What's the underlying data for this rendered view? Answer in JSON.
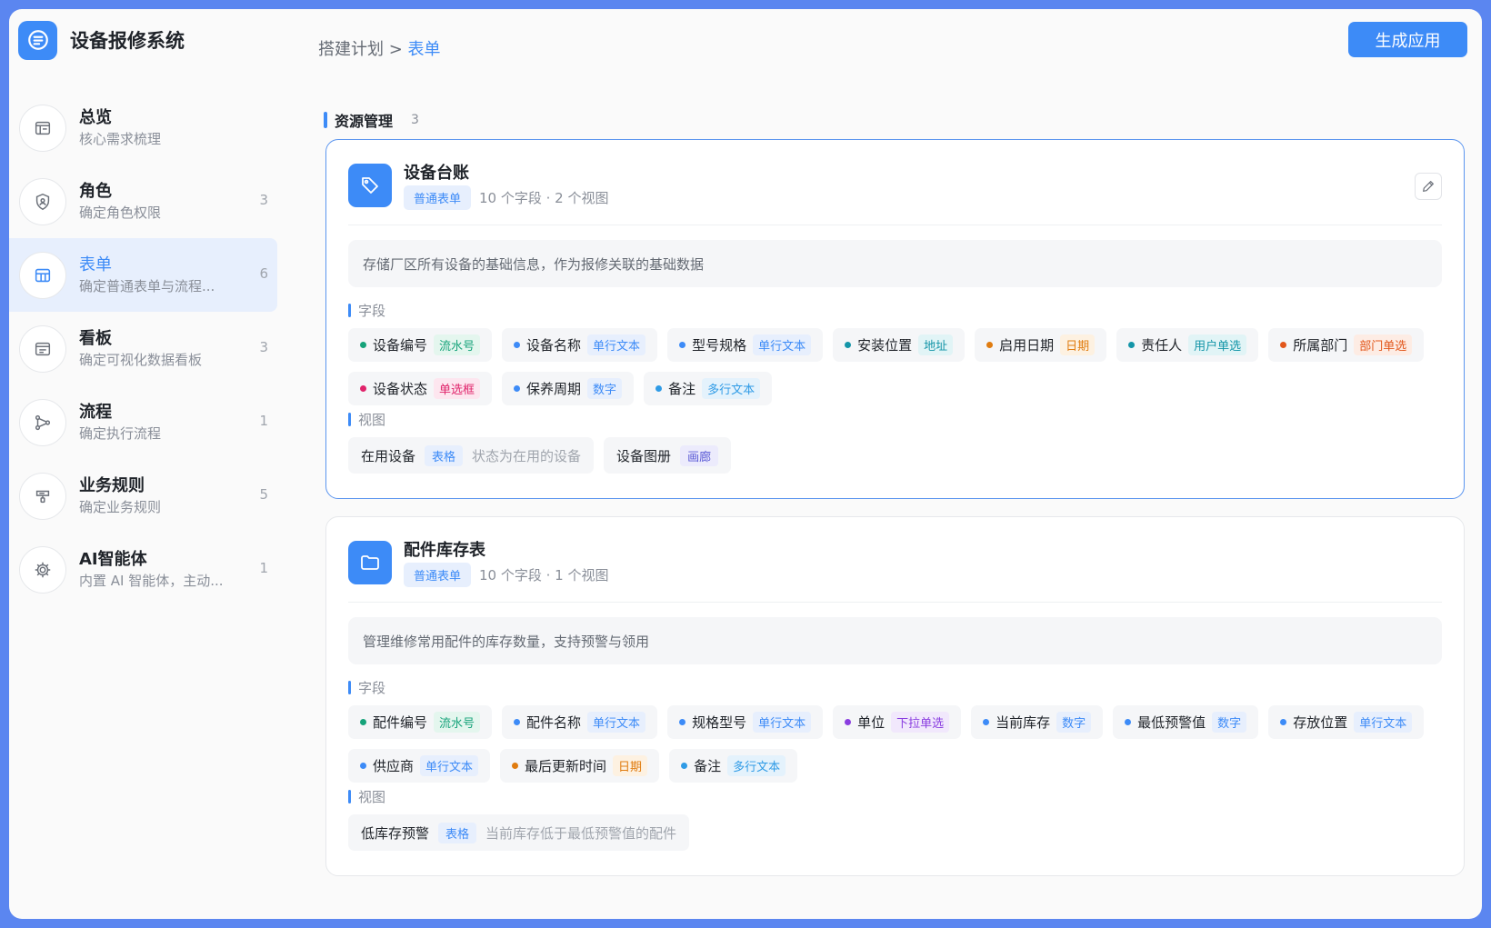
{
  "app": {
    "title": "设备报修系统"
  },
  "breadcrumb": {
    "parent": "搭建计划 >",
    "current": "表单"
  },
  "header": {
    "generate_label": "生成应用"
  },
  "sidebar": {
    "items": [
      {
        "title": "总览",
        "subtitle": "核心需求梳理",
        "count": "",
        "icon": "overview-icon"
      },
      {
        "title": "角色",
        "subtitle": "确定角色权限",
        "count": "3",
        "icon": "shield-user-icon"
      },
      {
        "title": "表单",
        "subtitle": "确定普通表单与流程...",
        "count": "6",
        "icon": "table-icon"
      },
      {
        "title": "看板",
        "subtitle": "确定可视化数据看板",
        "count": "3",
        "icon": "dashboard-icon"
      },
      {
        "title": "流程",
        "subtitle": "确定执行流程",
        "count": "1",
        "icon": "flow-icon"
      },
      {
        "title": "业务规则",
        "subtitle": "确定业务规则",
        "count": "5",
        "icon": "rule-icon"
      },
      {
        "title": "AI智能体",
        "subtitle": "内置 AI 智能体，主动...",
        "count": "1",
        "icon": "ai-agent-icon"
      }
    ]
  },
  "section": {
    "title": "资源管理",
    "count": "3"
  },
  "labels": {
    "fields": "字段",
    "views": "视图"
  },
  "cards": [
    {
      "title": "设备台账",
      "type": "普通表单",
      "meta": "10 个字段 · 2 个视图",
      "icon": "tag-icon",
      "description": "存储厂区所有设备的基础信息，作为报修关联的基础数据",
      "fields": [
        {
          "name": "设备编号",
          "type": "流水号",
          "dot": "#16a37a",
          "tag_color": "#16a37a",
          "tag_bg": "#e4f6ee"
        },
        {
          "name": "设备名称",
          "type": "单行文本",
          "dot": "#3d8bf7",
          "tag_color": "#3d8bf7",
          "tag_bg": "#e7effd"
        },
        {
          "name": "型号规格",
          "type": "单行文本",
          "dot": "#3d8bf7",
          "tag_color": "#3d8bf7",
          "tag_bg": "#e7effd"
        },
        {
          "name": "安装位置",
          "type": "地址",
          "dot": "#1495a8",
          "tag_color": "#1495a8",
          "tag_bg": "#e1f4f6"
        },
        {
          "name": "启用日期",
          "type": "日期",
          "dot": "#e07c10",
          "tag_color": "#e07c10",
          "tag_bg": "#fdf1e1"
        },
        {
          "name": "责任人",
          "type": "用户单选",
          "dot": "#1495a8",
          "tag_color": "#1495a8",
          "tag_bg": "#e1f4f6"
        },
        {
          "name": "所属部门",
          "type": "部门单选",
          "dot": "#e2571c",
          "tag_color": "#e2571c",
          "tag_bg": "#fdece4"
        },
        {
          "name": "设备状态",
          "type": "单选框",
          "dot": "#e0246b",
          "tag_color": "#e0246b",
          "tag_bg": "#fde6ef"
        },
        {
          "name": "保养周期",
          "type": "数字",
          "dot": "#3d8bf7",
          "tag_color": "#3d8bf7",
          "tag_bg": "#e7effd"
        },
        {
          "name": "备注",
          "type": "多行文本",
          "dot": "#2f9be6",
          "tag_color": "#2f9be6",
          "tag_bg": "#e4f2fc"
        }
      ],
      "views": [
        {
          "name": "在用设备",
          "type": "表格",
          "desc": "状态为在用的设备",
          "type_color": "#3d8bf7",
          "type_bg": "#e7effd"
        },
        {
          "name": "设备图册",
          "type": "画廊",
          "desc": "",
          "type_color": "#5b5bd6",
          "type_bg": "#ecebfc"
        }
      ]
    },
    {
      "title": "配件库存表",
      "type": "普通表单",
      "meta": "10 个字段 · 1 个视图",
      "icon": "folder-icon",
      "description": "管理维修常用配件的库存数量，支持预警与领用",
      "fields": [
        {
          "name": "配件编号",
          "type": "流水号",
          "dot": "#16a37a",
          "tag_color": "#16a37a",
          "tag_bg": "#e4f6ee"
        },
        {
          "name": "配件名称",
          "type": "单行文本",
          "dot": "#3d8bf7",
          "tag_color": "#3d8bf7",
          "tag_bg": "#e7effd"
        },
        {
          "name": "规格型号",
          "type": "单行文本",
          "dot": "#3d8bf7",
          "tag_color": "#3d8bf7",
          "tag_bg": "#e7effd"
        },
        {
          "name": "单位",
          "type": "下拉单选",
          "dot": "#8a3ee0",
          "tag_color": "#8a3ee0",
          "tag_bg": "#f1e8fc"
        },
        {
          "name": "当前库存",
          "type": "数字",
          "dot": "#3d8bf7",
          "tag_color": "#3d8bf7",
          "tag_bg": "#e7effd"
        },
        {
          "name": "最低预警值",
          "type": "数字",
          "dot": "#3d8bf7",
          "tag_color": "#3d8bf7",
          "tag_bg": "#e7effd"
        },
        {
          "name": "存放位置",
          "type": "单行文本",
          "dot": "#3d8bf7",
          "tag_color": "#3d8bf7",
          "tag_bg": "#e7effd"
        },
        {
          "name": "供应商",
          "type": "单行文本",
          "dot": "#3d8bf7",
          "tag_color": "#3d8bf7",
          "tag_bg": "#e7effd"
        },
        {
          "name": "最后更新时间",
          "type": "日期",
          "dot": "#e07c10",
          "tag_color": "#e07c10",
          "tag_bg": "#fdf1e1"
        },
        {
          "name": "备注",
          "type": "多行文本",
          "dot": "#2f9be6",
          "tag_color": "#2f9be6",
          "tag_bg": "#e4f2fc"
        }
      ],
      "views": [
        {
          "name": "低库存预警",
          "type": "表格",
          "desc": "当前库存低于最低预警值的配件",
          "type_color": "#3d8bf7",
          "type_bg": "#e7effd"
        }
      ]
    }
  ]
}
